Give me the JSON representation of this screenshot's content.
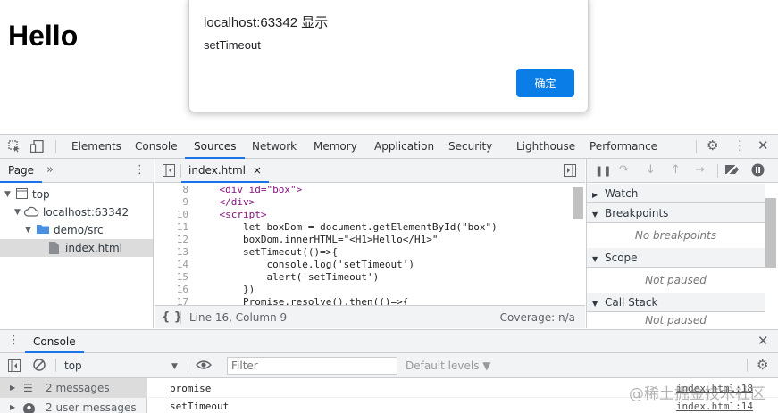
{
  "page": {
    "heading": "Hello"
  },
  "alert": {
    "title": "localhost:63342 显示",
    "message": "setTimeout",
    "ok_label": "确定"
  },
  "devtools": {
    "tabs": [
      {
        "label": "Elements"
      },
      {
        "label": "Console"
      },
      {
        "label": "Sources"
      },
      {
        "label": "Network"
      },
      {
        "label": "Memory"
      },
      {
        "label": "Application"
      },
      {
        "label": "Security"
      },
      {
        "label": "Lighthouse"
      },
      {
        "label": "Performance"
      }
    ],
    "active_tab": "Sources"
  },
  "navigator": {
    "tab_label": "Page",
    "more_label": "»",
    "tree": [
      {
        "label": "top"
      },
      {
        "label": "localhost:63342"
      },
      {
        "label": "demo/src"
      },
      {
        "label": "index.html"
      }
    ]
  },
  "editor": {
    "file_tab": "index.html",
    "close_glyph": "×",
    "lines": [
      {
        "n": "8",
        "text": "    <div id=\"box\">"
      },
      {
        "n": "9",
        "text": "    </div>"
      },
      {
        "n": "10",
        "text": "    <script>"
      },
      {
        "n": "11",
        "text": "        let boxDom = document.getElementById(\"box\")"
      },
      {
        "n": "12",
        "text": "        boxDom.innerHTML=\"<H1>Hello</H1>\""
      },
      {
        "n": "13",
        "text": "        setTimeout(()=>{"
      },
      {
        "n": "14",
        "text": "            console.log('setTimeout')"
      },
      {
        "n": "15",
        "text": "            alert('setTimeout')"
      },
      {
        "n": "16",
        "text": "        })"
      },
      {
        "n": "17",
        "text": "        Promise.resolve().then(()=>{"
      }
    ],
    "status": "Line 16, Column 9",
    "coverage": "Coverage: n/a",
    "format_glyph": "{ }"
  },
  "debugger": {
    "sections": [
      {
        "title": "Watch",
        "body": ""
      },
      {
        "title": "Breakpoints",
        "body": "No breakpoints"
      },
      {
        "title": "Scope",
        "body": "Not paused"
      },
      {
        "title": "Call Stack",
        "body": "Not paused"
      }
    ]
  },
  "console": {
    "drawer_tab": "Console",
    "context": "top",
    "filter_placeholder": "Filter",
    "levels_label": "Default levels ▼",
    "sidebar": [
      {
        "label": "2 messages"
      },
      {
        "label": "2 user messages"
      }
    ],
    "messages": [
      {
        "text": "promise",
        "source": "index.html:18"
      },
      {
        "text": "setTimeout",
        "source": "index.html:14"
      }
    ]
  },
  "watermark": "@稀土掘金技术社区"
}
